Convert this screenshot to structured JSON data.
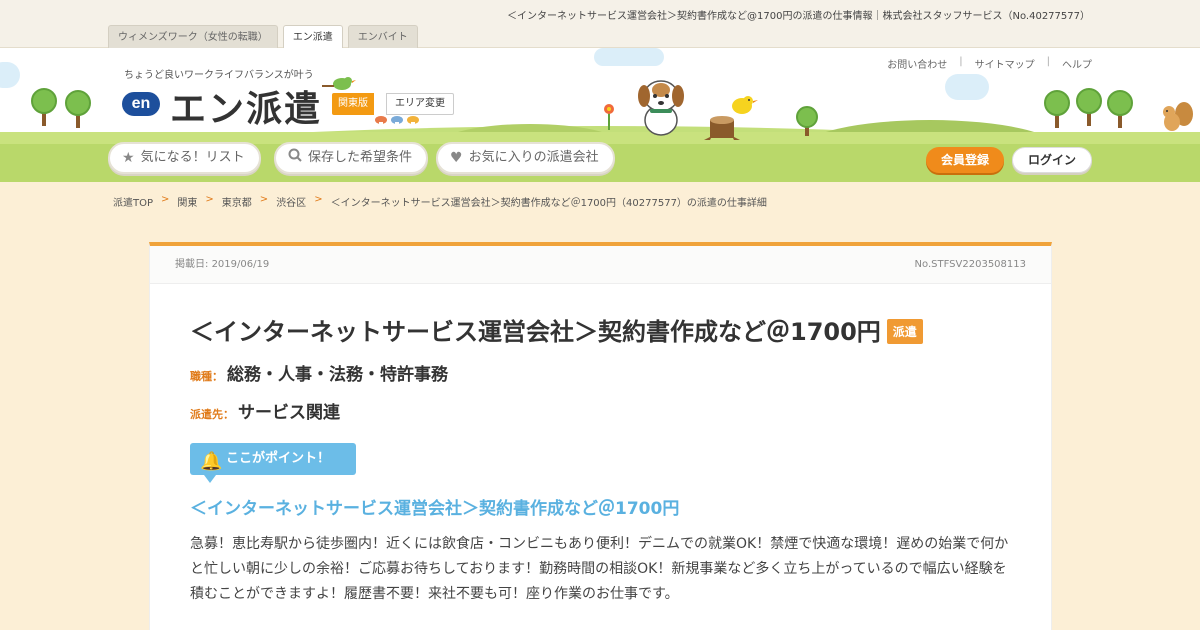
{
  "top": {
    "page_title": "＜インターネットサービス運営会社＞契約書作成など@1700円の派遣の仕事情報｜株式会社スタッフサービス（No.40277577）",
    "tabs": [
      {
        "label": "ウィメンズワーク（女性の転職）"
      },
      {
        "label": "エン派遣"
      },
      {
        "label": "エンバイト"
      }
    ]
  },
  "header": {
    "tagline": "ちょうど良いワークライフバランスが叶う",
    "logo_mark": "en",
    "logo_text": "エン派遣",
    "region": "関東版",
    "region_change": "エリア変更",
    "utility_links": [
      "お問い合わせ",
      "サイトマップ",
      "ヘルプ"
    ],
    "nav": [
      {
        "label": "気になる！リスト",
        "icon": "star-icon"
      },
      {
        "label": "保存した希望条件",
        "icon": "search-icon"
      },
      {
        "label": "お気に入りの派遣会社",
        "icon": "heart-icon"
      }
    ],
    "register": "会員登録",
    "login": "ログイン"
  },
  "breadcrumb": [
    "派遣TOP",
    "関東",
    "東京都",
    "渋谷区",
    "＜インターネットサービス運営会社＞契約書作成など＠1700円（40277577）の派遣の仕事詳細"
  ],
  "job": {
    "posted_label": "掲載日:",
    "posted_date": "2019/06/19",
    "number": "No.STFSV2203508113",
    "title": "＜インターネットサービス運営会社＞契約書作成など＠1700円",
    "badge": "派遣",
    "category_label": "職種：",
    "category": "総務・人事・法務・特許事務",
    "dispatch_label": "派遣先：",
    "dispatch": "サービス関連",
    "point_label": "ここがポイント！",
    "point_headline": "＜インターネットサービス運営会社＞契約書作成など＠1700円",
    "description": "急募！恵比寿駅から徒歩圏内！近くには飲食店・コンビニもあり便利！デニムでの就業OK！禁煙で快適な環境！遅めの始業で何かと忙しい朝に少しの余裕！ご応募お待ちしております！勤務時間の相談OK！新規事業など多く立ち上がっているので幅広い経験を積むことができますよ！履歴書不要！来社不要も可！座り作業のお仕事です。"
  },
  "colors": {
    "accent_orange": "#f08b1b",
    "point_blue": "#6cbde8",
    "headline_blue": "#5ab1e0"
  }
}
